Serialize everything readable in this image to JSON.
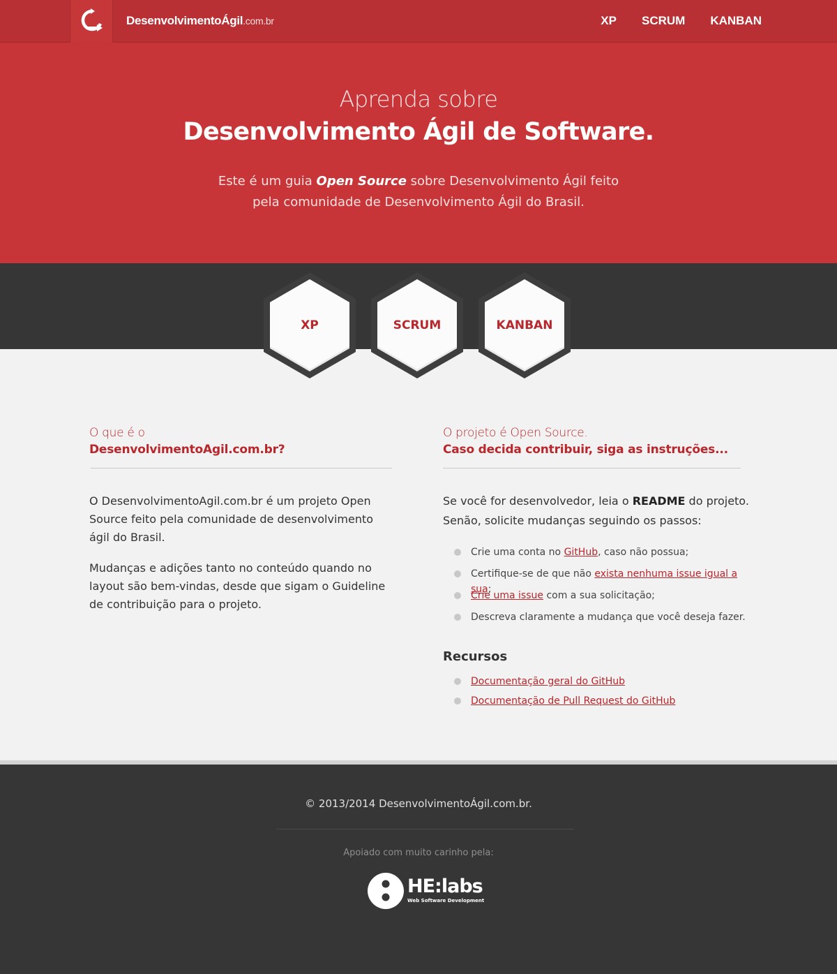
{
  "nav": {
    "brand_name": "DesenvolvimentoÁgil",
    "brand_tld": ".com.br",
    "links": [
      "XP",
      "SCRUM",
      "KANBAN"
    ]
  },
  "hero": {
    "pre_title": "Aprenda sobre",
    "title": "Desenvolvimento Ágil de Software.",
    "desc_before": "Este é um guia ",
    "desc_em": "Open Source",
    "desc_after": " sobre Desenvolvimento Ágil feito pela comunidade de Desenvolvimento Ágil do Brasil."
  },
  "hexes": [
    "XP",
    "SCRUM",
    "KANBAN"
  ],
  "left": {
    "pre_title": "O que é o",
    "title": "DesenvolvimentoAgil.com.br?",
    "para1": "O DesenvolvimentoAgil.com.br é um projeto Open Source feito pela comunidade de desenvolvimento ágil do Brasil.",
    "para2": "Mudanças e adições tanto no conteúdo quando no layout são bem-vindas, desde que sigam o Guideline de contribuição para o projeto."
  },
  "right": {
    "pre_title": "O projeto é Open Source.",
    "title": "Caso decida contribuir, siga as instruções...",
    "intro_before": "Se você for desenvolvedor, leia o ",
    "intro_bold": "README",
    "intro_after": " do projeto. Senão, solicite mudanças seguindo os passos:",
    "steps": [
      {
        "before": "Crie uma conta no ",
        "link": "GitHub",
        "after": ", caso não possua;"
      },
      {
        "before": "Certifique-se de que não ",
        "link": "exista nenhuma issue igual a sua",
        "after": ";"
      },
      {
        "before": "",
        "link": "Crie uma issue",
        "after": " com a sua solicitação;"
      },
      {
        "before": "Descreva claramente a mudança que você deseja fazer.",
        "link": "",
        "after": ""
      }
    ],
    "resources_title": "Recursos",
    "resources": [
      "Documentação geral do GitHub",
      "Documentação de Pull Request do GitHub"
    ]
  },
  "footer": {
    "copyright": "© 2013/2014 DesenvolvimentoÁgil.com.br.",
    "support": "Apoiado com muito carinho  pela:",
    "sponsor_name": "HE:labs",
    "sponsor_tagline": "Web Software Development"
  },
  "colors": {
    "nav": "#b93034",
    "hero": "#c73538",
    "accent": "#b8272c",
    "dark": "#363636",
    "page": "#f2f2f2"
  }
}
